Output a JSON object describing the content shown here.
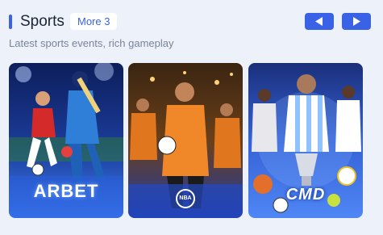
{
  "header": {
    "title": "Sports",
    "more_label": "More 3",
    "accent_color": "#3a62e6",
    "prev_icon": "triangle-left-icon",
    "next_icon": "triangle-right-icon"
  },
  "subtitle": "Latest sports events, rich gameplay",
  "cards": [
    {
      "logo": "ARBET",
      "scene": "football-and-cricket-players-in-stadium"
    },
    {
      "logo": "NBA",
      "scene": "football-players-in-orange-kits"
    },
    {
      "logo": "CMD",
      "scene": "football-player-with-trophy-and-balls"
    }
  ]
}
